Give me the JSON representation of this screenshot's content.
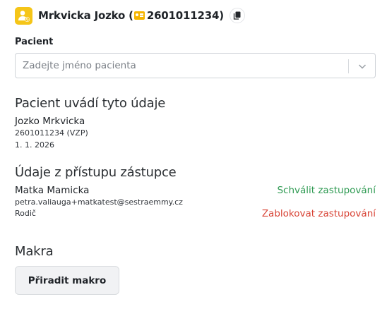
{
  "header": {
    "patient_name": "Mrkvicka Jozko",
    "open_paren": " (",
    "insurance_number": "2601011234",
    "close_paren": ")"
  },
  "patient_field": {
    "label": "Pacient",
    "placeholder": "Zadejte jméno pacienta"
  },
  "patient_reported": {
    "title": "Pacient uvádí tyto údaje",
    "name": "Jozko Mrkvicka",
    "insurance": "2601011234 (VZP)",
    "birth_date": "1. 1. 2026"
  },
  "representative": {
    "title": "Údaje z přístupu zástupce",
    "name": "Matka Mamicka",
    "email": "petra.valiauga+matkatest@sestraemmy.cz",
    "relation": "Rodič",
    "approve_label": "Schválit zastupování",
    "block_label": "Zablokovat zastupování"
  },
  "macros": {
    "title": "Makra",
    "assign_label": "Přiradit makro"
  },
  "colors": {
    "avatar": "#f5c518",
    "approve": "#2e9a52",
    "block": "#d84335"
  }
}
